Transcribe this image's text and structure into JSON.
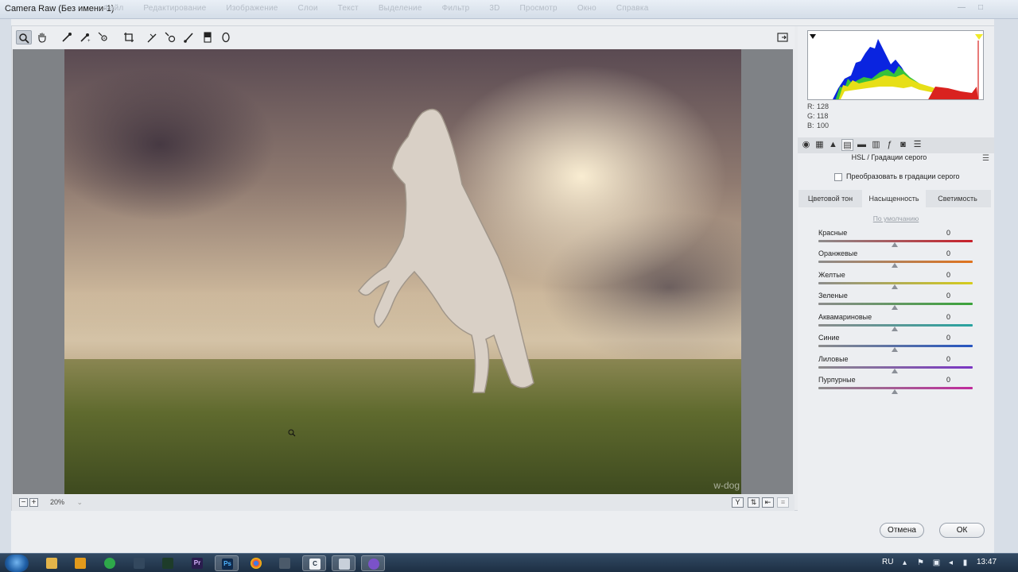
{
  "window": {
    "title": "Camera Raw (Без имени-1)",
    "ghost_menu": [
      "Файл",
      "Редактирование",
      "Изображение",
      "Слои",
      "Текст",
      "Выделение",
      "Фильтр",
      "3D",
      "Просмотр",
      "Окно",
      "Справка"
    ]
  },
  "toolbar": {
    "tools": [
      "zoom-tool",
      "hand-tool",
      "white-balance-tool",
      "color-sampler-tool",
      "targeted-adjustment-tool",
      "crop-tool",
      "straighten-tool",
      "spot-removal-tool",
      "red-eye-tool",
      "adjustment-brush",
      "graduated-filter",
      "radial-filter"
    ],
    "fullscreen_icon": "fullscreen-icon"
  },
  "preview": {
    "watermark": "w-dog",
    "zoom_level": "20%"
  },
  "readout": {
    "r_label": "R:",
    "r_value": "128",
    "g_label": "G:",
    "g_value": "118",
    "b_label": "B:",
    "b_value": "100"
  },
  "panel": {
    "title": "HSL / Градации серого",
    "grayscale_label": "Преобразовать в градации серого",
    "subtabs": [
      "Цветовой тон",
      "Насыщенность",
      "Светимость"
    ],
    "active_subtab": "Насыщенность",
    "default_link": "По умолчанию",
    "sliders": [
      {
        "label": "Красные",
        "value": "0",
        "color": "#c8202a"
      },
      {
        "label": "Оранжевые",
        "value": "0",
        "color": "#e0731d"
      },
      {
        "label": "Желтые",
        "value": "0",
        "color": "#d6cc1c"
      },
      {
        "label": "Зеленые",
        "value": "0",
        "color": "#3aa33a"
      },
      {
        "label": "Аквамариновые",
        "value": "0",
        "color": "#27a3a0"
      },
      {
        "label": "Синие",
        "value": "0",
        "color": "#2554c0"
      },
      {
        "label": "Лиловые",
        "value": "0",
        "color": "#7a35c4"
      },
      {
        "label": "Пурпурные",
        "value": "0",
        "color": "#c02a9c"
      }
    ]
  },
  "buttons": {
    "cancel": "Отмена",
    "ok": "ОК"
  },
  "taskbar": {
    "language": "RU",
    "clock": "13:47"
  }
}
